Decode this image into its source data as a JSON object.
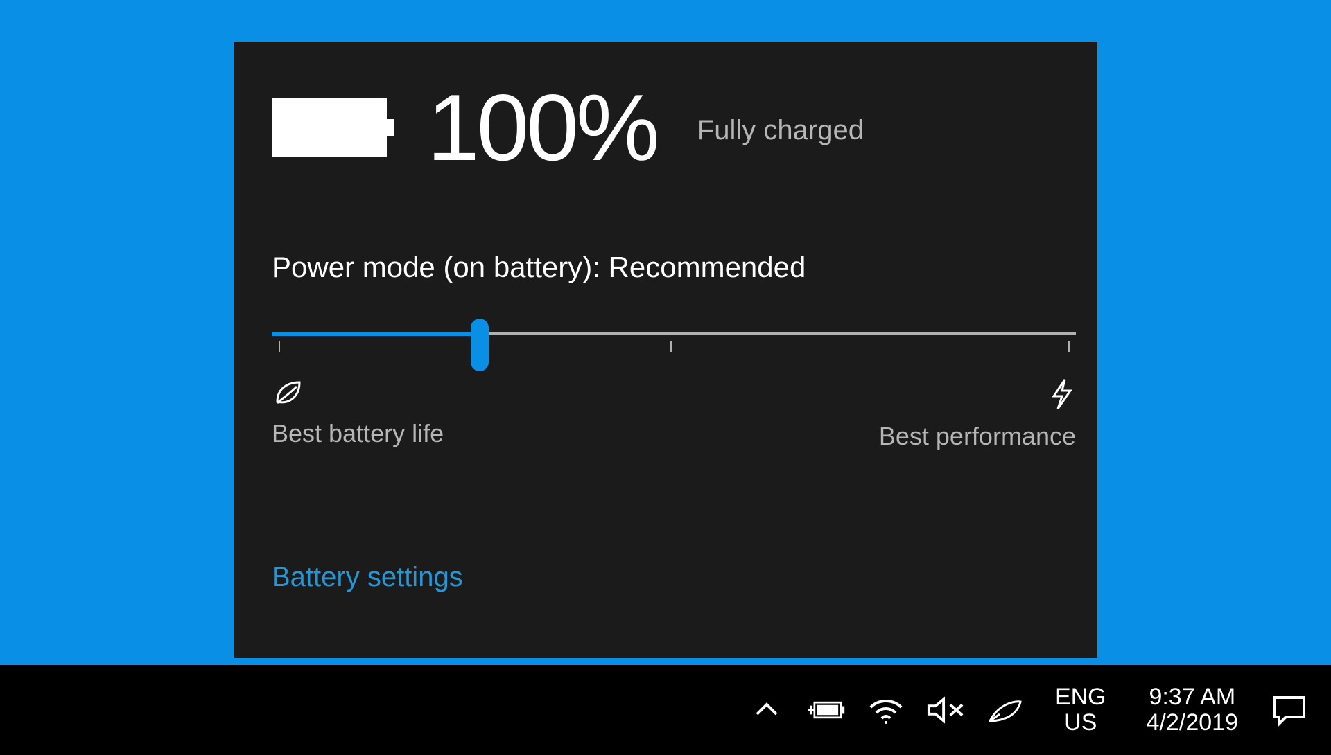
{
  "flyout": {
    "percent": "100%",
    "status": "Fully charged",
    "power_mode_label": "Power mode (on battery): Recommended",
    "slider": {
      "left_label": "Best battery life",
      "right_label": "Best performance",
      "value_percent": 26
    },
    "link": "Battery settings"
  },
  "taskbar": {
    "lang_top": "ENG",
    "lang_bottom": "US",
    "time": "9:37 AM",
    "date": "4/2/2019"
  },
  "colors": {
    "accent": "#0a8fe6",
    "panel": "#1b1b1b"
  }
}
